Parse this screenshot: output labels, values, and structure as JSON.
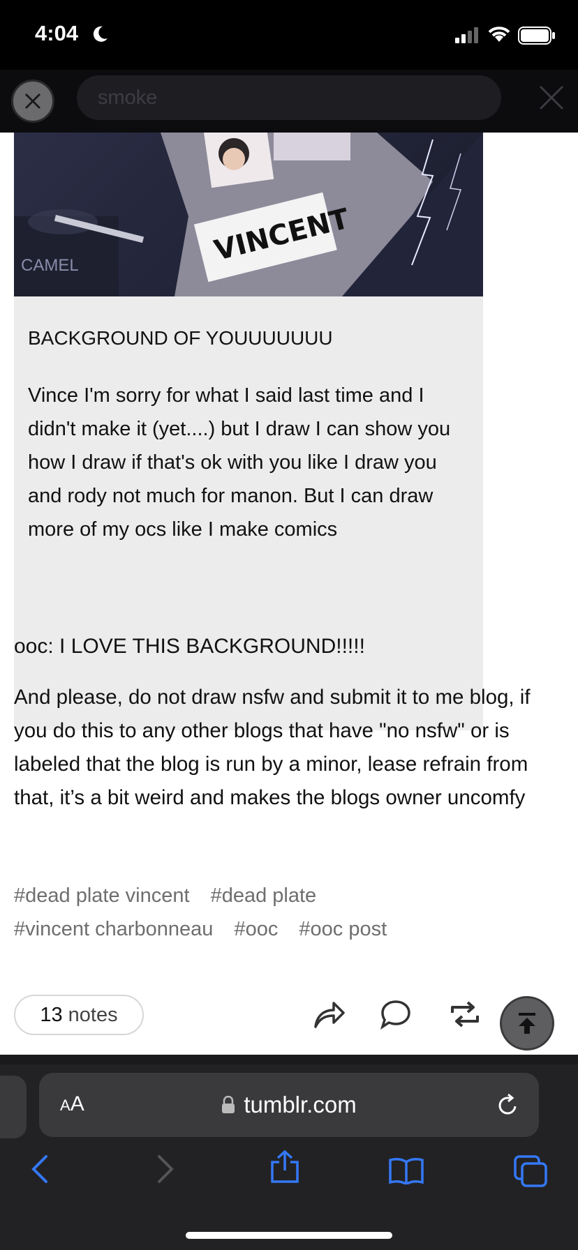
{
  "status_bar": {
    "time": "4:04",
    "icons": [
      "moon-icon",
      "signal-icon",
      "wifi-icon",
      "battery-icon"
    ]
  },
  "search": {
    "query": "smoke"
  },
  "post": {
    "image_text": {
      "sticker": "VINCENT",
      "pack": "CAMEL"
    },
    "ask_title": "BACKGROUND OF YOUUUUUUU",
    "ask_body": "Vince I'm sorry for what I said last time and I didn't make it (yet....) but I draw I can show you how I draw if that's ok with you like I draw you and rody not much for manon. But I can draw more of my ocs like I make comics",
    "reply_1": "ooc: I LOVE THIS BACKGROUND!!!!!",
    "reply_2": "And please, do not draw nsfw and submit it to me blog, if you do this to any other blogs that have \"no nsfw\" or is labeled that the blog is run by a minor, lease refrain from that, it’s a bit weird and makes the blogs owner uncomfy",
    "tags": [
      "#dead plate vincent",
      "#dead plate",
      "#vincent charbonneau",
      "#ooc",
      "#ooc post"
    ],
    "notes_count": "13",
    "notes_label": "notes",
    "actions": [
      "share-icon",
      "reply-icon",
      "reblog-icon",
      "scroll-top-icon"
    ]
  },
  "browser": {
    "aa_label_small": "A",
    "aa_label_big": "A",
    "url": "tumblr.com",
    "toolbar": [
      "back-icon",
      "forward-icon",
      "share-icon",
      "bookmarks-icon",
      "tabs-icon"
    ]
  },
  "colors": {
    "accent": "#3478f6",
    "chrome": "#222224",
    "tag_gray": "#6e6e6e"
  }
}
